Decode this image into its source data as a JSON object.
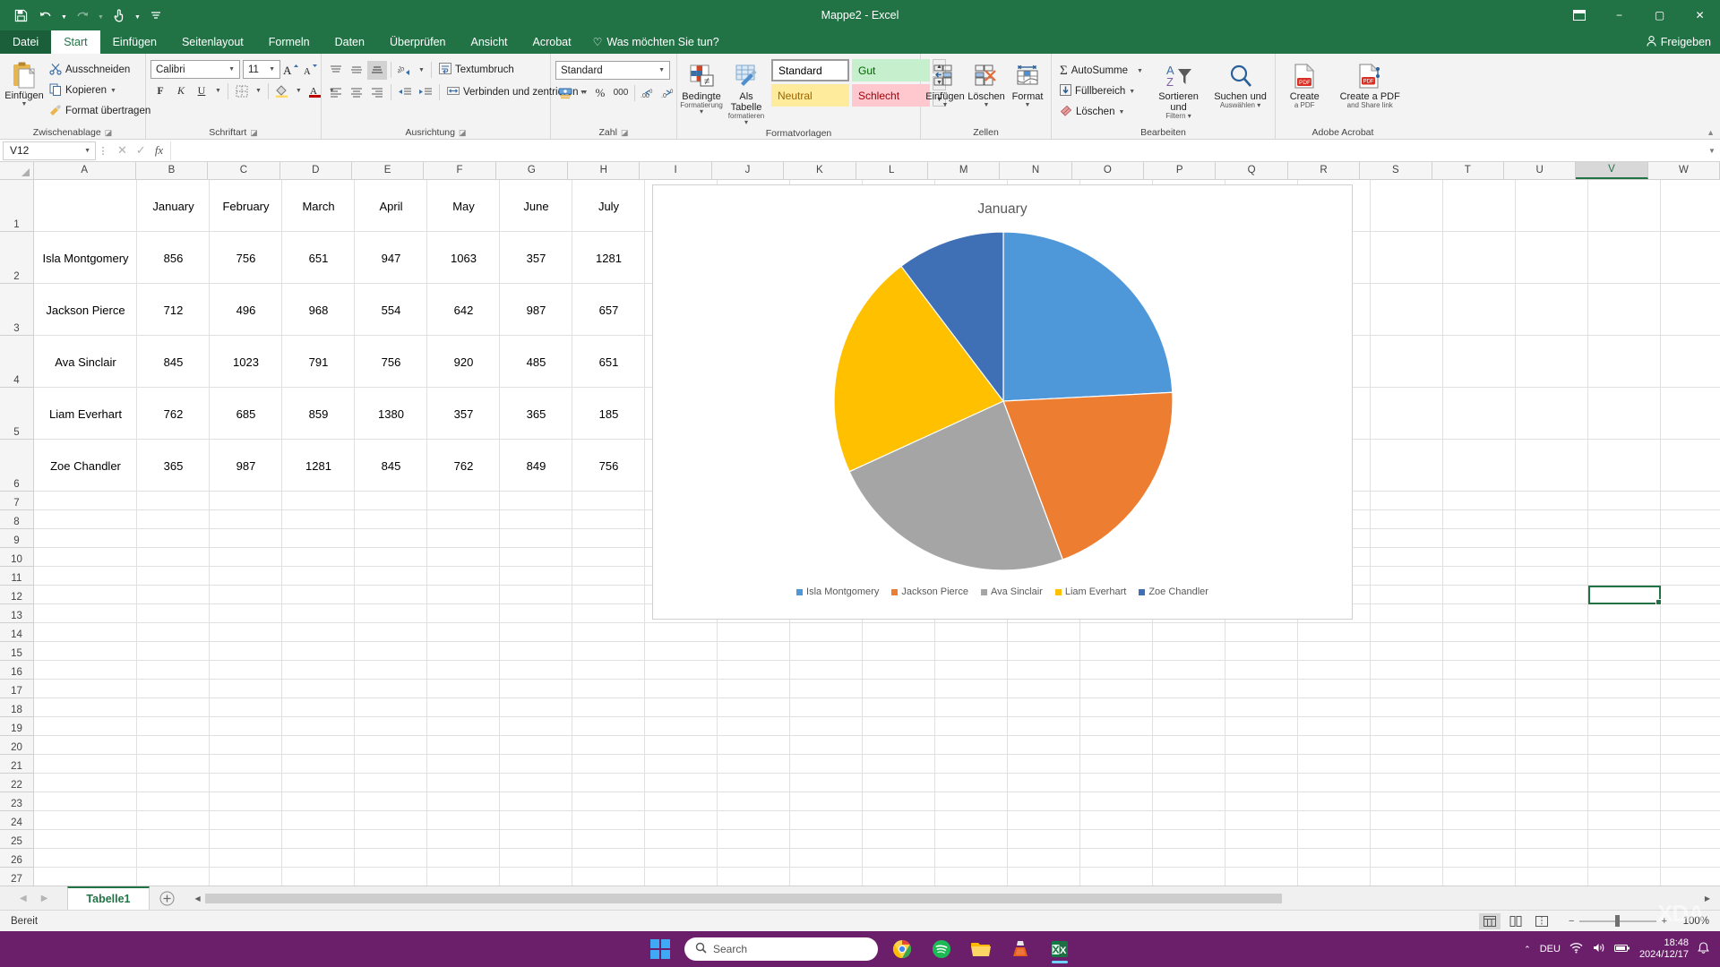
{
  "window": {
    "title": "Mappe2 - Excel",
    "minimize": "−",
    "maximize": "▢",
    "close": "✕",
    "restore_icon": "restore-down-icon"
  },
  "quick_access": {
    "save": "Speichern",
    "undo": "Rückgängig",
    "redo": "Wiederholen",
    "touch": "Touch-/Mausmodus",
    "customize": "Symbolleiste für den Schnellzugriff anpassen"
  },
  "tabs": [
    {
      "label": "Datei",
      "active": false,
      "file": true
    },
    {
      "label": "Start",
      "active": true,
      "file": false
    },
    {
      "label": "Einfügen",
      "active": false,
      "file": false
    },
    {
      "label": "Seitenlayout",
      "active": false,
      "file": false
    },
    {
      "label": "Formeln",
      "active": false,
      "file": false
    },
    {
      "label": "Daten",
      "active": false,
      "file": false
    },
    {
      "label": "Überprüfen",
      "active": false,
      "file": false
    },
    {
      "label": "Ansicht",
      "active": false,
      "file": false
    },
    {
      "label": "Acrobat",
      "active": false,
      "file": false
    }
  ],
  "tell_me": "Was möchten Sie tun?",
  "share": "Freigeben",
  "ribbon": {
    "groups": {
      "clipboard": {
        "label": "Zwischenablage",
        "paste": "Einfügen",
        "cut": "Ausschneiden",
        "copy": "Kopieren",
        "format_painter": "Format übertragen"
      },
      "font": {
        "label": "Schriftart",
        "font_name": "Calibri",
        "font_size": "11",
        "grow": "A",
        "shrink": "A",
        "bold": "F",
        "italic": "K",
        "underline": "U",
        "borders": "Rahmen",
        "fill_color": "Füllfarbe",
        "font_color": "Schriftfarbe"
      },
      "alignment": {
        "label": "Ausrichtung",
        "wrap_text": "Textumbruch",
        "merge_center": "Verbinden und zentrieren",
        "orientation": "Ausrichtung",
        "indent_dec": "Einzug verkleinern",
        "indent_inc": "Einzug vergrößern"
      },
      "number": {
        "label": "Zahl",
        "format": "Standard",
        "accounting": "Buchhaltungszahlenformat",
        "percent": "%",
        "thousands": "000",
        "inc_decimal": "Dezimalstelle hinzufügen",
        "dec_decimal": "Dezimalstelle löschen"
      },
      "styles": {
        "label": "Formatvorlagen",
        "conditional": "Bedingte",
        "conditional2": "Formatierung",
        "as_table": "Als Tabelle",
        "as_table2": "formatieren",
        "cells": [
          {
            "label": "Standard",
            "bg": "#ffffff",
            "fg": "#000000",
            "border": "#9a9a9a"
          },
          {
            "label": "Gut",
            "bg": "#c6efce",
            "fg": "#006100",
            "border": "#c6efce"
          },
          {
            "label": "Neutral",
            "bg": "#ffeb9c",
            "fg": "#9c6500",
            "border": "#ffeb9c"
          },
          {
            "label": "Schlecht",
            "bg": "#ffc7ce",
            "fg": "#9c0006",
            "border": "#ffc7ce"
          }
        ]
      },
      "cells": {
        "label": "Zellen",
        "insert": "Einfügen",
        "delete": "Löschen",
        "format": "Format"
      },
      "editing": {
        "label": "Bearbeiten",
        "autosum": "AutoSumme",
        "fill": "Füllbereich",
        "clear": "Löschen",
        "sort_filter": "Sortieren und",
        "sort_filter2": "Filtern",
        "find_select": "Suchen und",
        "find_select2": "Auswählen"
      },
      "acrobat": {
        "label": "Adobe Acrobat",
        "create_pdf": "Create",
        "create_pdf2": "a PDF",
        "create_share": "Create a PDF",
        "create_share2": "and Share link"
      }
    }
  },
  "formula_bar": {
    "name_box": "V12",
    "cancel": "✕",
    "confirm": "✓",
    "fx": "fx",
    "value": "",
    "placeholder": ""
  },
  "grid": {
    "columns": [
      "A",
      "B",
      "C",
      "D",
      "E",
      "F",
      "G",
      "H",
      "I",
      "J",
      "K",
      "L",
      "M",
      "N",
      "O",
      "P",
      "Q",
      "R",
      "S",
      "T",
      "U",
      "V",
      "W"
    ],
    "selected_column": "V",
    "rows": [
      1,
      2,
      3,
      4,
      5,
      6,
      7,
      8,
      9,
      10,
      11,
      12,
      13,
      14,
      15,
      16,
      17,
      18,
      19,
      20,
      21,
      22,
      23,
      24,
      25,
      26,
      27
    ],
    "selected_cell": "V12",
    "headers": [
      "",
      "January",
      "February",
      "March",
      "April",
      "May",
      "June",
      "July"
    ],
    "data": [
      {
        "name": "Isla Montgomery",
        "values": [
          856,
          756,
          651,
          947,
          1063,
          357,
          1281
        ]
      },
      {
        "name": "Jackson Pierce",
        "values": [
          712,
          496,
          968,
          554,
          642,
          987,
          657
        ]
      },
      {
        "name": "Ava Sinclair",
        "values": [
          845,
          1023,
          791,
          756,
          920,
          485,
          651
        ]
      },
      {
        "name": "Liam Everhart",
        "values": [
          762,
          685,
          859,
          1380,
          357,
          365,
          185
        ]
      },
      {
        "name": "Zoe Chandler",
        "values": [
          365,
          987,
          1281,
          845,
          762,
          849,
          756
        ]
      }
    ]
  },
  "chart_data": {
    "type": "pie",
    "title": "January",
    "categories": [
      "Isla Montgomery",
      "Jackson Pierce",
      "Ava Sinclair",
      "Liam Everhart",
      "Zoe Chandler"
    ],
    "values": [
      856,
      712,
      845,
      762,
      365
    ],
    "colors": [
      "#4e97d9",
      "#ed7d31",
      "#a5a5a5",
      "#ffc000",
      "#3f6fb5"
    ],
    "legend_position": "bottom",
    "xlabel": "",
    "ylabel": "",
    "grid": false
  },
  "sheet_tabs": {
    "tabs": [
      "Tabelle1"
    ],
    "active": "Tabelle1",
    "add_label": "+",
    "prev": "◀",
    "next": "▶"
  },
  "status_bar": {
    "state": "Bereit",
    "view_normal": "Normal",
    "view_layout": "Seitenlayout",
    "view_break": "Umbruchvorschau",
    "zoom": "100%"
  },
  "taskbar": {
    "search_placeholder": "Search",
    "apps": [
      "chrome-icon",
      "spotify-icon",
      "file-explorer-icon",
      "vlc-icon",
      "excel-icon"
    ],
    "language": "DEU",
    "time": "18:48",
    "date": "2024/12/17",
    "watermark": "XDA"
  }
}
